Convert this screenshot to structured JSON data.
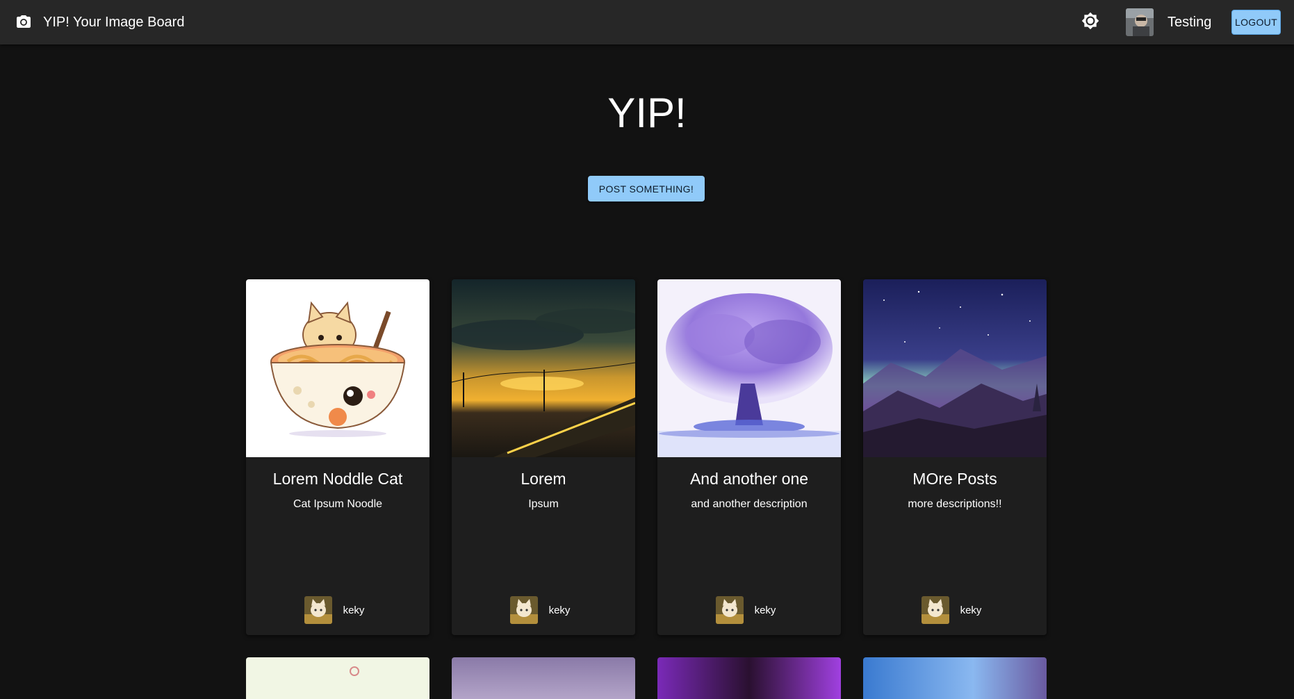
{
  "header": {
    "brand_title": "YIP! Your Image Board",
    "brand_icon": "camera-icon",
    "theme_icon": "brightness-icon",
    "user_name": "Testing",
    "logout_label": "LOGOUT"
  },
  "hero": {
    "title": "YIP!",
    "post_button_label": "POST SOMETHING!"
  },
  "posts": [
    {
      "title": "Lorem Noddle Cat",
      "description": "Cat Ipsum Noodle",
      "author": "keky",
      "image": "cat-noodle-bowl"
    },
    {
      "title": "Lorem",
      "description": "Ipsum",
      "author": "keky",
      "image": "sunset-railway"
    },
    {
      "title": "And another one",
      "description": "and another description",
      "author": "keky",
      "image": "purple-tree"
    },
    {
      "title": "MOre Posts",
      "description": "more descriptions!!",
      "author": "keky",
      "image": "starry-mountains"
    }
  ],
  "colors": {
    "background": "#121212",
    "appbar": "#272727",
    "card": "#1e1e1e",
    "accent": "#90caf9"
  }
}
